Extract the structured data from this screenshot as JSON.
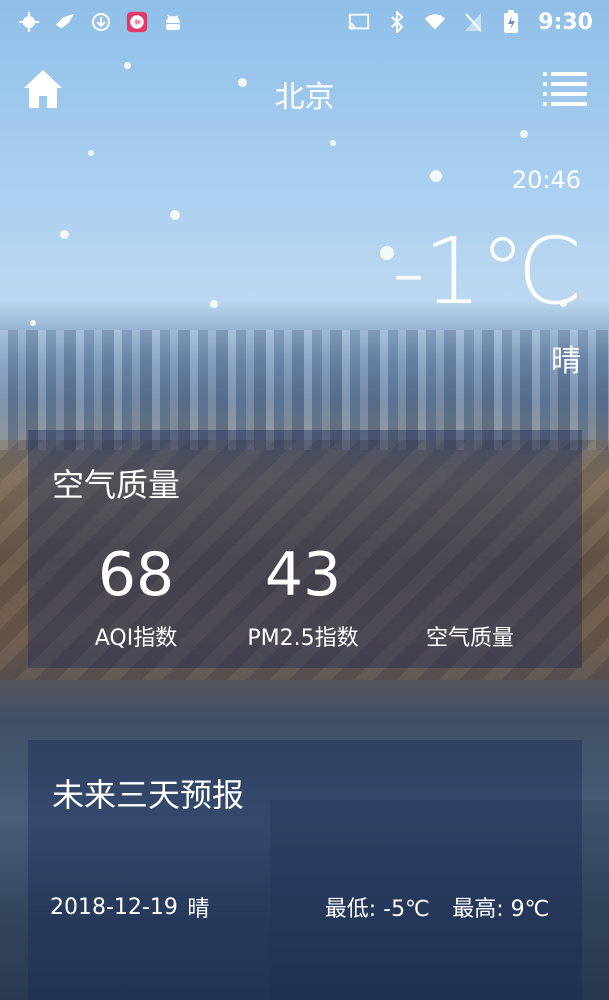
{
  "status_bar": {
    "time": "9:30",
    "left_icons": [
      "notification-icon",
      "bird-icon",
      "download-icon",
      "voice-app-icon",
      "android-icon"
    ],
    "right_icons": [
      "cast-icon",
      "bluetooth-icon",
      "wifi-icon",
      "no-sim-icon",
      "battery-charging-icon"
    ]
  },
  "header": {
    "city": "北京",
    "home_icon": "home-icon",
    "menu_icon": "menu-icon"
  },
  "current": {
    "update_time": "20:46",
    "temperature": "-1℃",
    "weather": "晴"
  },
  "air_quality": {
    "title": "空气质量",
    "aqi_value": "68",
    "aqi_label": "AQI指数",
    "pm25_value": "43",
    "pm25_label": "PM2.5指数",
    "quality_label": "空气质量"
  },
  "forecast": {
    "title": "未来三天预报",
    "rows": [
      {
        "date": "2018-12-19",
        "weather": "晴",
        "min": "最低: -5℃",
        "max": "最高: 9℃"
      }
    ]
  }
}
